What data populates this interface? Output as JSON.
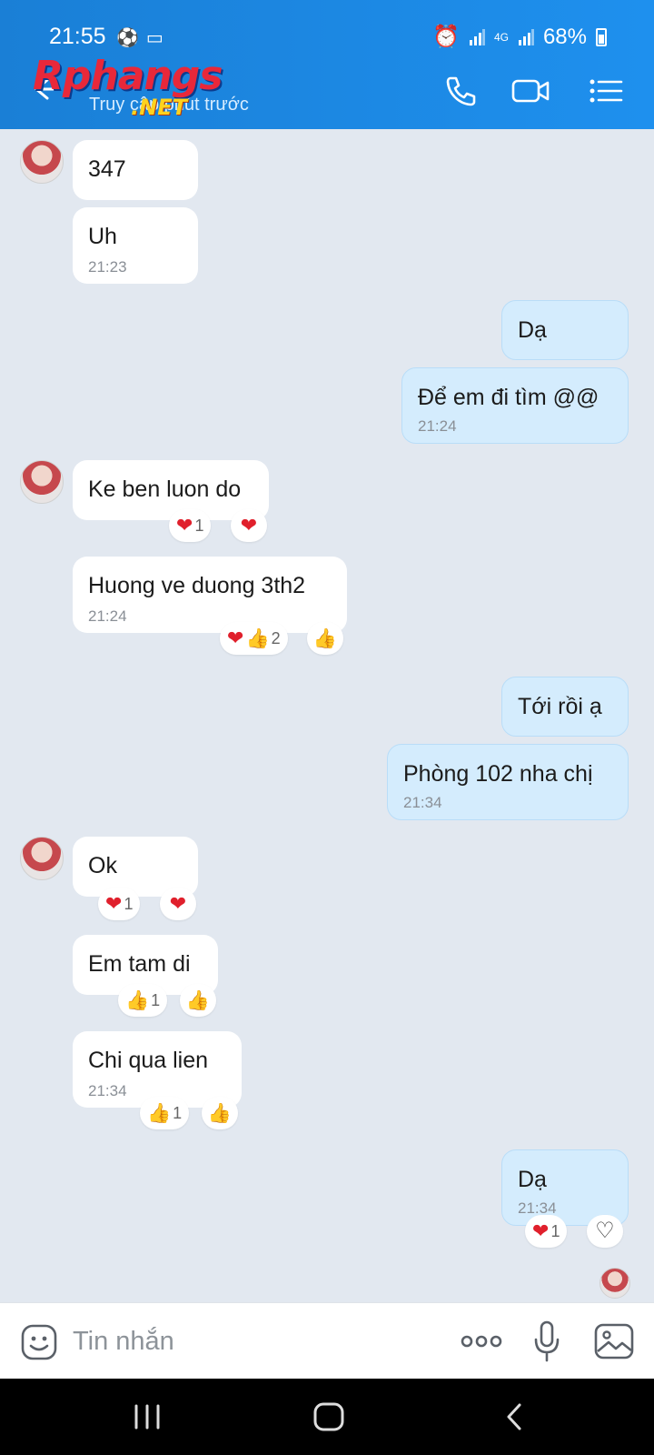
{
  "status": {
    "time": "21:55",
    "network": "4G",
    "battery": "68%"
  },
  "header": {
    "logo": "Rphangs",
    "logo_suffix": ".NET",
    "subtitle": "Truy cập phút trước"
  },
  "messages": [
    {
      "id": "m1",
      "side": "in",
      "text": "347"
    },
    {
      "id": "m2",
      "side": "in",
      "text": "Uh",
      "time": "21:23"
    },
    {
      "id": "m3",
      "side": "out",
      "text": "Dạ"
    },
    {
      "id": "m4",
      "side": "out",
      "text": "Để em đi tìm @@",
      "time": "21:24"
    },
    {
      "id": "m5",
      "side": "in",
      "text": "Ke ben luon do",
      "reactions": [
        {
          "icons": "heart",
          "count": "1"
        },
        {
          "icons": "heart"
        }
      ]
    },
    {
      "id": "m6",
      "side": "in",
      "text": "Huong ve duong 3th2",
      "time": "21:24",
      "reactions": [
        {
          "icons": "heart+thumb",
          "count": "2"
        },
        {
          "icons": "thumb"
        }
      ]
    },
    {
      "id": "m7",
      "side": "out",
      "text": "Tới rồi ạ"
    },
    {
      "id": "m8",
      "side": "out",
      "text": "Phòng 102 nha chị",
      "time": "21:34"
    },
    {
      "id": "m9",
      "side": "in",
      "text": "Ok",
      "reactions": [
        {
          "icons": "heart",
          "count": "1"
        },
        {
          "icons": "heart"
        }
      ]
    },
    {
      "id": "m10",
      "side": "in",
      "text": "Em tam di",
      "reactions": [
        {
          "icons": "thumb",
          "count": "1"
        },
        {
          "icons": "thumb"
        }
      ]
    },
    {
      "id": "m11",
      "side": "in",
      "text": "Chi qua lien",
      "time": "21:34",
      "reactions": [
        {
          "icons": "thumb",
          "count": "1"
        },
        {
          "icons": "thumb"
        }
      ]
    },
    {
      "id": "m12",
      "side": "out",
      "text": "Dạ",
      "time": "21:34",
      "reactions": [
        {
          "icons": "heart",
          "count": "1"
        },
        {
          "icons": "heart-outline"
        }
      ]
    }
  ],
  "composer": {
    "placeholder": "Tin nhắn"
  },
  "colors": {
    "header": "#1e90ee",
    "incoming": "#ffffff",
    "outgoing": "#d4ecfd",
    "background": "#e2e8f0"
  }
}
